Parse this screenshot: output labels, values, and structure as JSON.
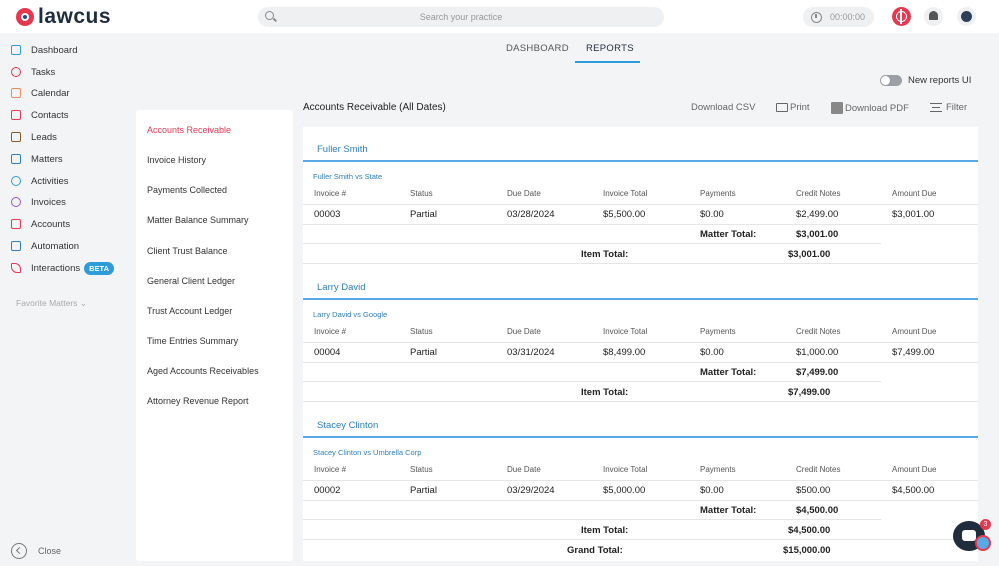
{
  "app": {
    "name": "lawcus"
  },
  "search": {
    "placeholder": "Search your practice"
  },
  "timer": {
    "value": "00:00:00"
  },
  "sidebar": {
    "items": [
      {
        "label": "Dashboard",
        "icon": "home-icon",
        "color": "#2d9cdb"
      },
      {
        "label": "Tasks",
        "icon": "check-circle-icon",
        "color": "#e8384f"
      },
      {
        "label": "Calendar",
        "icon": "calendar-icon",
        "color": "#f08a5d"
      },
      {
        "label": "Contacts",
        "icon": "contacts-icon",
        "color": "#e8384f"
      },
      {
        "label": "Leads",
        "icon": "briefcase-icon",
        "color": "#8b5a2b"
      },
      {
        "label": "Matters",
        "icon": "folder-icon",
        "color": "#2d7fc0"
      },
      {
        "label": "Activities",
        "icon": "stopwatch-icon",
        "color": "#2d9cdb"
      },
      {
        "label": "Invoices",
        "icon": "invoice-icon",
        "color": "#9b51e0"
      },
      {
        "label": "Accounts",
        "icon": "bank-icon",
        "color": "#e8384f"
      },
      {
        "label": "Automation",
        "icon": "automation-icon",
        "color": "#2d7fc0"
      },
      {
        "label": "Interactions",
        "icon": "phone-icon",
        "color": "#e8384f"
      }
    ],
    "beta_label": "BETA",
    "favorites_label": "Favorite Matters",
    "close_label": "Close"
  },
  "tabs": {
    "dashboard": "DASHBOARD",
    "reports": "REPORTS"
  },
  "new_reports_ui": "New reports UI",
  "report_list": [
    "Accounts Receivable",
    "Invoice History",
    "Payments Collected",
    "Matter Balance Summary",
    "General Client Ledger",
    "General Client Ledger",
    "Trust Account Ledger",
    "Time Entries Summary",
    "Aged Accounts Receivables",
    "Attorney Revenue Report"
  ],
  "report": {
    "title": "Accounts Receivable  (All Dates)",
    "download_csv": "Download CSV",
    "print": "Print",
    "download_pdf": "Download PDF",
    "filter": "Filter",
    "columns": [
      "Invoice #",
      "Status",
      "Due Date",
      "Invoice Total",
      "Payments",
      "Credit Notes",
      "Amount Due"
    ],
    "matter_total_label": "Matter Total:",
    "item_total_label": "Item Total:",
    "grand_total_label": "Grand Total:",
    "grand_total": "$15,000.00",
    "clients": [
      {
        "name": "Fuller Smith",
        "matter": "Fuller Smith vs State",
        "row": [
          "00003",
          "Partial",
          "03/28/2024",
          "$5,500.00",
          "$0.00",
          "$2,499.00",
          "$3,001.00"
        ],
        "matter_total": "$3,001.00",
        "item_total": "$3,001.00"
      },
      {
        "name": "Larry David",
        "matter": "Larry David vs Google",
        "row": [
          "00004",
          "Partial",
          "03/31/2024",
          "$8,499.00",
          "$0.00",
          "$1,000.00",
          "$7,499.00"
        ],
        "matter_total": "$7,499.00",
        "item_total": "$7,499.00"
      },
      {
        "name": "Stacey Clinton",
        "matter": "Stacey Clinton vs Umbrella Corp",
        "row": [
          "00002",
          "Partial",
          "03/29/2024",
          "$5,000.00",
          "$0.00",
          "$500.00",
          "$4,500.00"
        ],
        "matter_total": "$4,500.00",
        "item_total": "$4,500.00"
      }
    ]
  },
  "chat_badge": "3"
}
